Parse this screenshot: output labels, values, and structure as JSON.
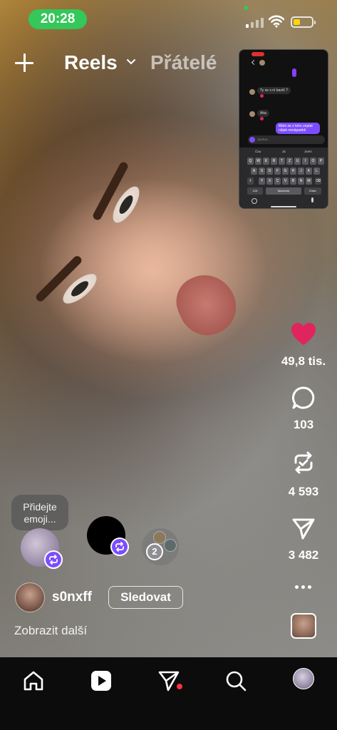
{
  "status_bar": {
    "time": "20:28"
  },
  "header": {
    "add_label": "+",
    "tab_reels": "Reels",
    "tab_friends": "Přátelé"
  },
  "pip": {
    "msg_in_1": "Ty se s ní bavíš ?",
    "msg_in_2": "Aha",
    "msg_out_1": "Mám se z toho zeptat nějak nenápadně",
    "composer_placeholder": "Zpráva...",
    "suggestions": [
      "Čau",
      "Já",
      "Jsem"
    ],
    "keys_row1": [
      "Q",
      "W",
      "E",
      "R",
      "T",
      "Z",
      "U",
      "I",
      "O",
      "P"
    ],
    "keys_row2": [
      "A",
      "S",
      "D",
      "F",
      "G",
      "H",
      "J",
      "K",
      "L"
    ],
    "keys_row3": [
      "Y",
      "X",
      "C",
      "V",
      "B",
      "N",
      "M"
    ],
    "key_123": "123",
    "key_space": "Mezerník",
    "key_enter": "Enter"
  },
  "rail": {
    "likes": "49,8 tis.",
    "comments": "103",
    "reposts": "4 593",
    "shares": "3 482"
  },
  "overlay": {
    "emoji_hint": "Přidejte emoji...",
    "friends_count": "2",
    "username": "s0nxff",
    "follow_label": "Sledovat",
    "show_more": "Zobrazit další"
  },
  "colors": {
    "like": "#e0245e",
    "repost_badge": "#7b4dff",
    "time_pill": "#34c759",
    "notif_dot": "#ff3040"
  }
}
